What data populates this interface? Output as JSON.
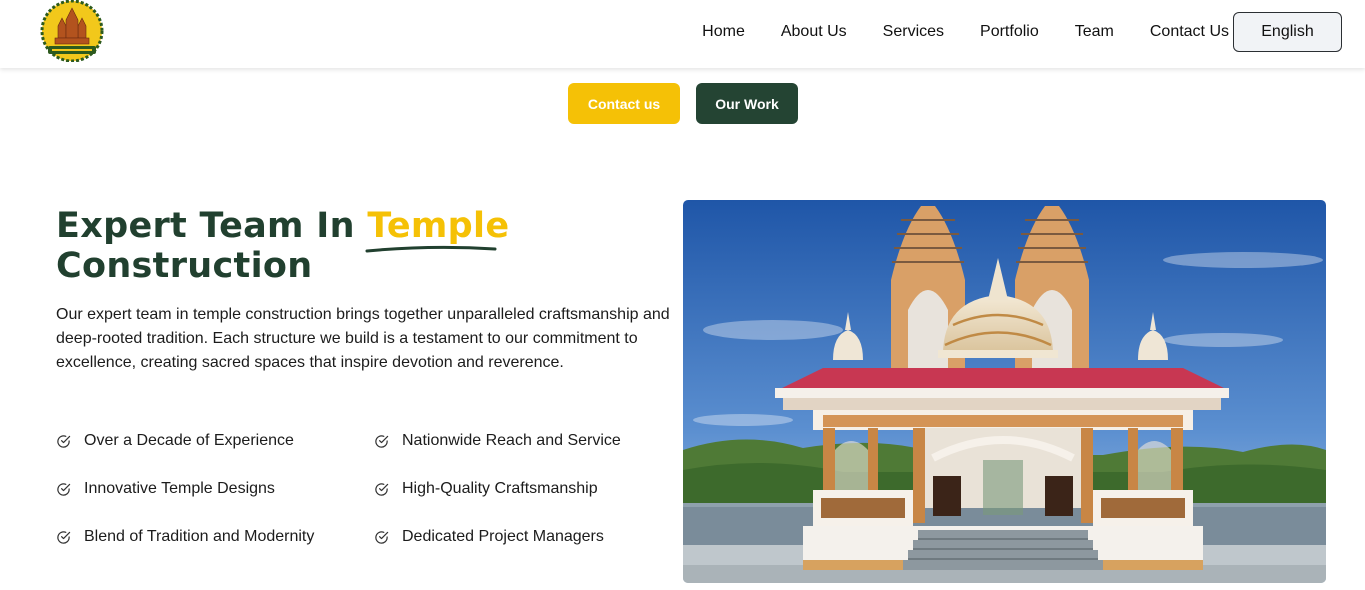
{
  "header": {
    "nav": [
      "Home",
      "About Us",
      "Services",
      "Portfolio",
      "Team",
      "Contact Us"
    ],
    "language": "English"
  },
  "cta": {
    "contact_label": "Contact us",
    "work_label": "Our Work"
  },
  "section": {
    "heading_part1": "Expert Team In",
    "heading_highlight": "Temple",
    "heading_part2": "Construction",
    "description": "Our expert team in temple construction brings together unparalleled craftsmanship and deep-rooted tradition. Each structure we build is a testament to our commitment to excellence, creating sacred spaces that inspire devotion and reverence.",
    "features": [
      "Over a Decade of Experience",
      "Nationwide Reach and Service",
      "Innovative Temple Designs",
      "High-Quality Craftsmanship",
      "Blend of Tradition and Modernity",
      "Dedicated Project Managers"
    ]
  },
  "colors": {
    "brand_yellow": "#f5c106",
    "brand_green": "#244433",
    "heading_green": "#21402f"
  },
  "icons": {
    "feature": "check-circle-icon"
  }
}
